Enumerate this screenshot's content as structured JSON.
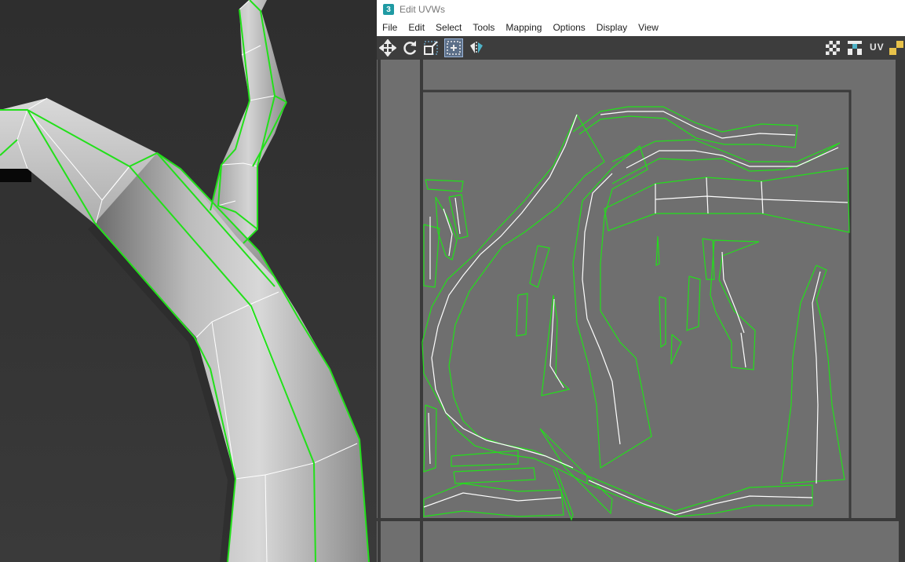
{
  "window": {
    "app_icon_glyph": "3",
    "title": "Edit UVWs"
  },
  "menu": [
    "File",
    "Edit",
    "Select",
    "Tools",
    "Mapping",
    "Options",
    "Display",
    "View"
  ],
  "toolbar": {
    "tools": [
      "move-icon",
      "rotate-icon",
      "scale-icon",
      "freeform-icon",
      "mirror-icon"
    ],
    "right_tools": [
      "checker-pattern-icon",
      "checker-map-icon"
    ],
    "uv_label": "UV"
  },
  "colors": {
    "selection_edge": "#22e01a",
    "uv_edge": "#ffffff",
    "uv_background": "#6f6f6f",
    "tile_border": "#3a3a3a"
  }
}
